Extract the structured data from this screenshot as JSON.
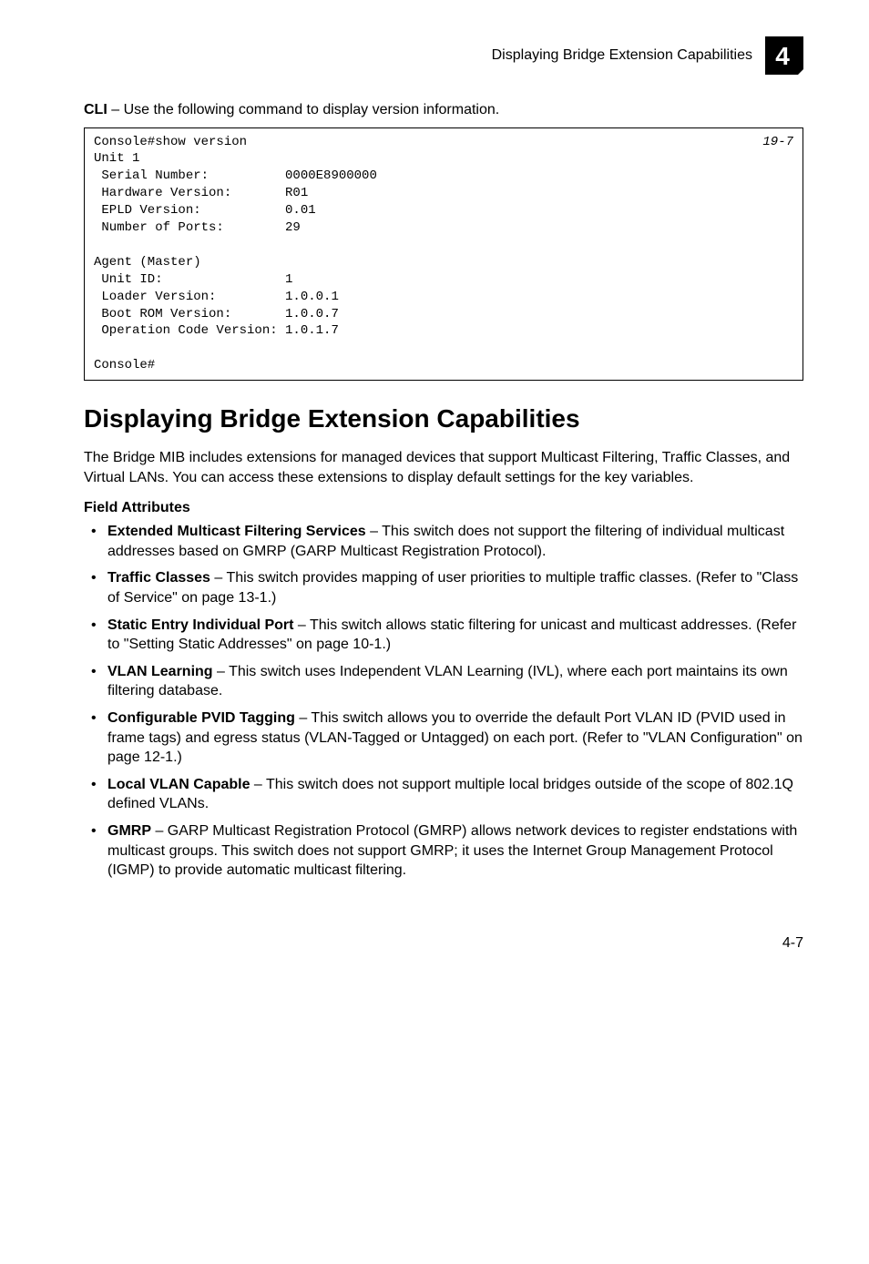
{
  "header": {
    "title": "Displaying Bridge Extension Capabilities",
    "chapter_number": "4"
  },
  "intro_cli_label": "CLI",
  "intro_cli_text": " – Use the following command to display version information.",
  "code_ref": "19-7",
  "code_text": "Console#show version\nUnit 1\n Serial Number:          0000E8900000\n Hardware Version:       R01\n EPLD Version:           0.01\n Number of Ports:        29\n\nAgent (Master)\n Unit ID:                1\n Loader Version:         1.0.0.1\n Boot ROM Version:       1.0.0.7\n Operation Code Version: 1.0.1.7\n\nConsole#",
  "section_title": "Displaying Bridge Extension Capabilities",
  "section_intro": "The Bridge MIB includes extensions for managed devices that support Multicast Filtering, Traffic Classes, and Virtual LANs. You can access these extensions to display default settings for the key variables.",
  "field_attributes_heading": "Field Attributes",
  "bullets": [
    {
      "term": "Extended Multicast Filtering Services",
      "desc": " – This switch does not support the filtering of individual multicast addresses based on GMRP (GARP Multicast Registration Protocol)."
    },
    {
      "term": "Traffic Classes",
      "desc": " – This switch provides mapping of user priorities to multiple traffic classes. (Refer to \"Class of Service\" on page 13-1.)"
    },
    {
      "term": "Static Entry Individual Port",
      "desc": " – This switch allows static filtering for unicast and multicast addresses. (Refer to \"Setting Static Addresses\" on page 10-1.)"
    },
    {
      "term": "VLAN Learning",
      "desc": " – This switch uses Independent VLAN Learning (IVL), where each port maintains its own filtering database."
    },
    {
      "term": "Configurable PVID Tagging",
      "desc": " – This switch allows you to override the default Port VLAN ID (PVID used in frame tags) and egress status (VLAN-Tagged or Untagged) on each port. (Refer to \"VLAN Configuration\" on page 12-1.)"
    },
    {
      "term": "Local VLAN Capable",
      "desc": " – This switch does not support multiple local bridges outside of the scope of 802.1Q defined VLANs."
    },
    {
      "term": "GMRP",
      "desc": " – GARP Multicast Registration Protocol (GMRP) allows network devices to register endstations with multicast groups. This switch does not support GMRP; it uses the Internet Group Management Protocol (IGMP) to provide automatic multicast filtering."
    }
  ],
  "page_number": "4-7"
}
